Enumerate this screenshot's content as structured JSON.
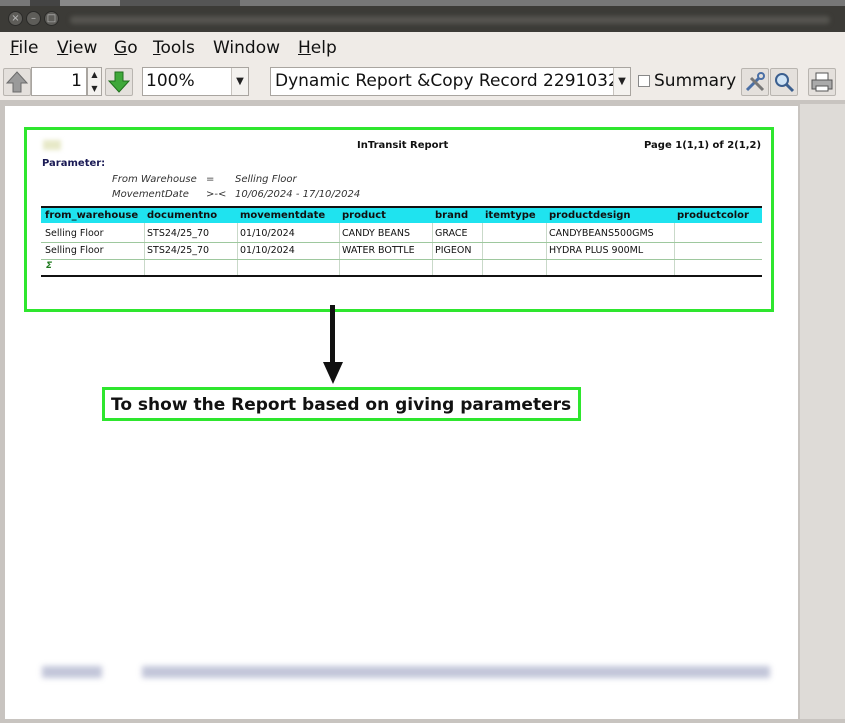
{
  "menu": {
    "items": [
      {
        "label": "File",
        "mnemonic": "F"
      },
      {
        "label": "View",
        "mnemonic": "V"
      },
      {
        "label": "Go",
        "mnemonic": "G"
      },
      {
        "label": "Tools",
        "mnemonic": "T"
      },
      {
        "label": "Window",
        "mnemonic": ""
      },
      {
        "label": "Help",
        "mnemonic": "H"
      }
    ]
  },
  "toolbar": {
    "page_number": "1",
    "zoom": "100%",
    "report_name": "Dynamic Report &Copy Record 2291032",
    "summary_label": "Summary",
    "summary_checked": false
  },
  "report": {
    "title": "InTransit Report",
    "page_info": "Page 1(1,1) of 2(1,2)",
    "parameter_heading": "Parameter:",
    "parameters": [
      {
        "name": "From Warehouse",
        "op": "=",
        "value": "Selling Floor"
      },
      {
        "name": "MovementDate",
        "op": ">-<",
        "value": "10/06/2024 - 17/10/2024"
      }
    ],
    "columns": [
      "from_warehouse",
      "documentno",
      "movementdate",
      "product",
      "brand",
      "itemtype",
      "productdesign",
      "productcolor"
    ],
    "rows": [
      [
        "Selling Floor",
        "STS24/25_70",
        "01/10/2024",
        "CANDY BEANS",
        "GRACE",
        "",
        "CANDYBEANS500GMS",
        ""
      ],
      [
        "Selling Floor",
        "STS24/25_70",
        "01/10/2024",
        "WATER BOTTLE",
        "PIGEON",
        "",
        "HYDRA PLUS 900ML",
        ""
      ]
    ],
    "sum_symbol": "Σ"
  },
  "annotation": {
    "callout_text": "To show the Report based on giving parameters"
  },
  "colors": {
    "highlight": "#2ee62e",
    "table_header": "#1fe3ef"
  }
}
